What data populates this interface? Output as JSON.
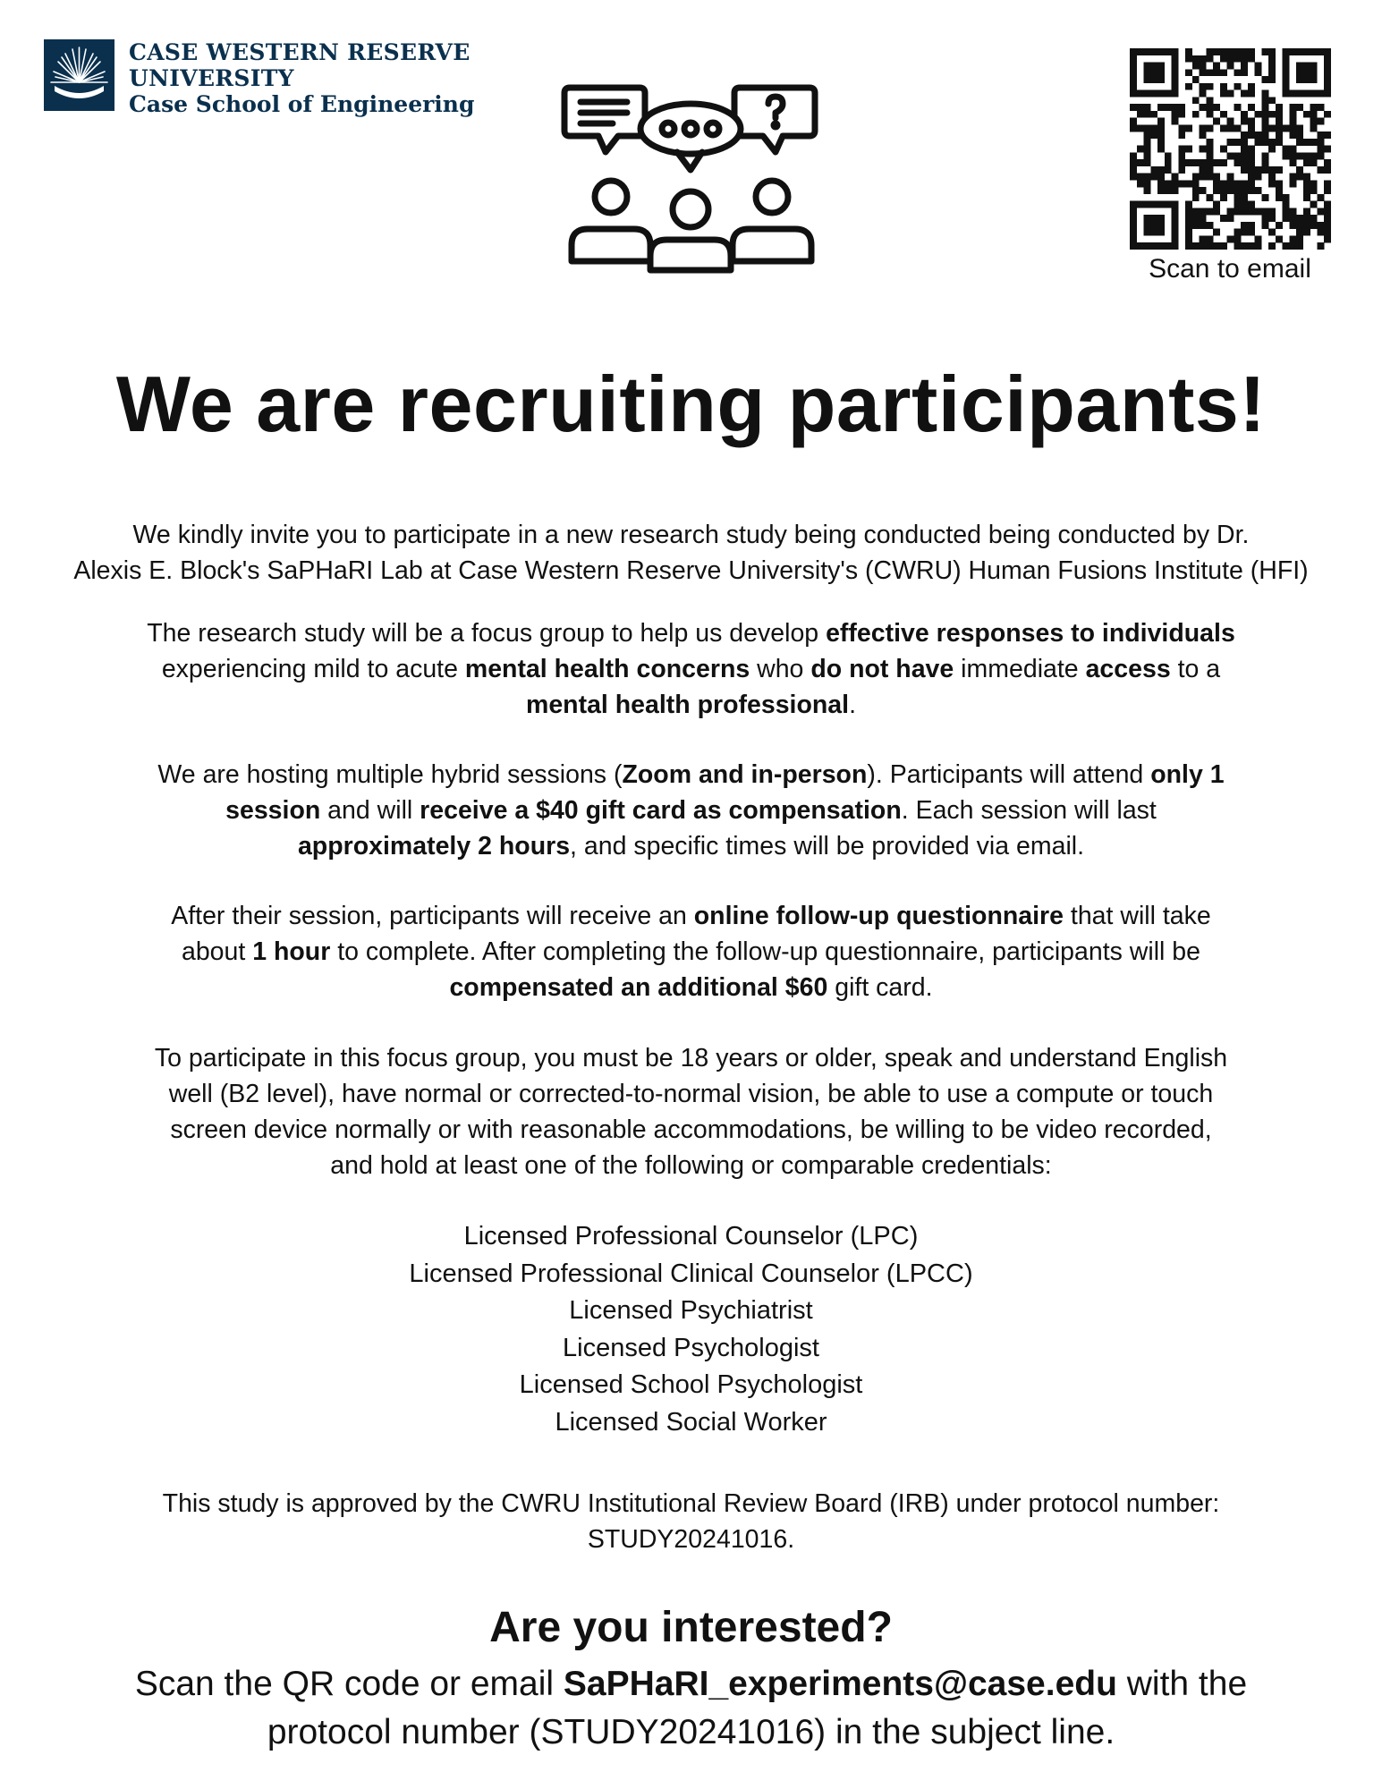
{
  "logo": {
    "line1": "CASE WESTERN RESERVE",
    "line2": "UNIVERSITY",
    "line3": "Case School of Engineering",
    "mark_icon": "starburst-icon",
    "color": "#0a304e"
  },
  "header_icon": "group-discussion-icon",
  "qr": {
    "icon": "qr-code-icon",
    "caption": "Scan to email"
  },
  "headline": "We are recruiting participants!",
  "intro": {
    "line1": "We kindly invite you to participate in a new research study being conducted being conducted by Dr.",
    "line2": "Alexis E. Block's SaPHaRI Lab at Case Western Reserve University's (CWRU) Human Fusions Institute (HFI)"
  },
  "purpose": {
    "t1": "The research study will be a focus group to help us develop ",
    "b1": "effective responses to individuals",
    "t2": "experiencing mild to acute ",
    "b2": "mental health concerns",
    "t3": " who ",
    "b3": "do not have",
    "t4": " immediate ",
    "b4": "access",
    "t5": " to a",
    "b5": "mental health professional",
    "t6": "."
  },
  "sessions": {
    "t1": "We are hosting multiple hybrid sessions (",
    "b1": "Zoom and in-person",
    "t2": "). Participants will attend ",
    "b2": "only 1",
    "b3": "session",
    "t3": " and will ",
    "b4": "receive a $40 gift card as compensation",
    "t4": ". Each session will last",
    "b5": "approximately 2 hours",
    "t5": ", and specific times will be provided via email."
  },
  "followup": {
    "t1": "After their session, participants will receive an ",
    "b1": "online follow-up questionnaire",
    "t2": " that will take",
    "t3": "about ",
    "b2": "1 hour",
    "t4": " to complete. After completing the follow-up questionnaire, participants will be",
    "b3": "compensated an additional $60",
    "t5": " gift card."
  },
  "eligibility": {
    "line1": "To participate in this focus group, you must be 18 years or older, speak and understand English",
    "line2": "well (B2 level), have normal or corrected-to-normal vision, be able to use a compute or touch",
    "line3": "screen device normally or with reasonable accommodations, be willing to be video recorded,",
    "line4": "and hold at least one of the following or comparable credentials:"
  },
  "credentials": [
    "Licensed Professional Counselor (LPC)",
    "Licensed Professional Clinical Counselor (LPCC)",
    "Licensed Psychiatrist",
    "Licensed Psychologist",
    "Licensed School Psychologist",
    "Licensed Social Worker"
  ],
  "irb": {
    "line1": "This study is approved by the CWRU Institutional Review Board (IRB) under protocol number:",
    "line2": "STUDY20241016."
  },
  "cta": {
    "heading": "Are you interested?",
    "t1": "Scan the QR code or email ",
    "email": "SaPHaRI_experiments@case.edu",
    "t2": " with the",
    "t3": "protocol number (STUDY20241016) in the subject line."
  }
}
